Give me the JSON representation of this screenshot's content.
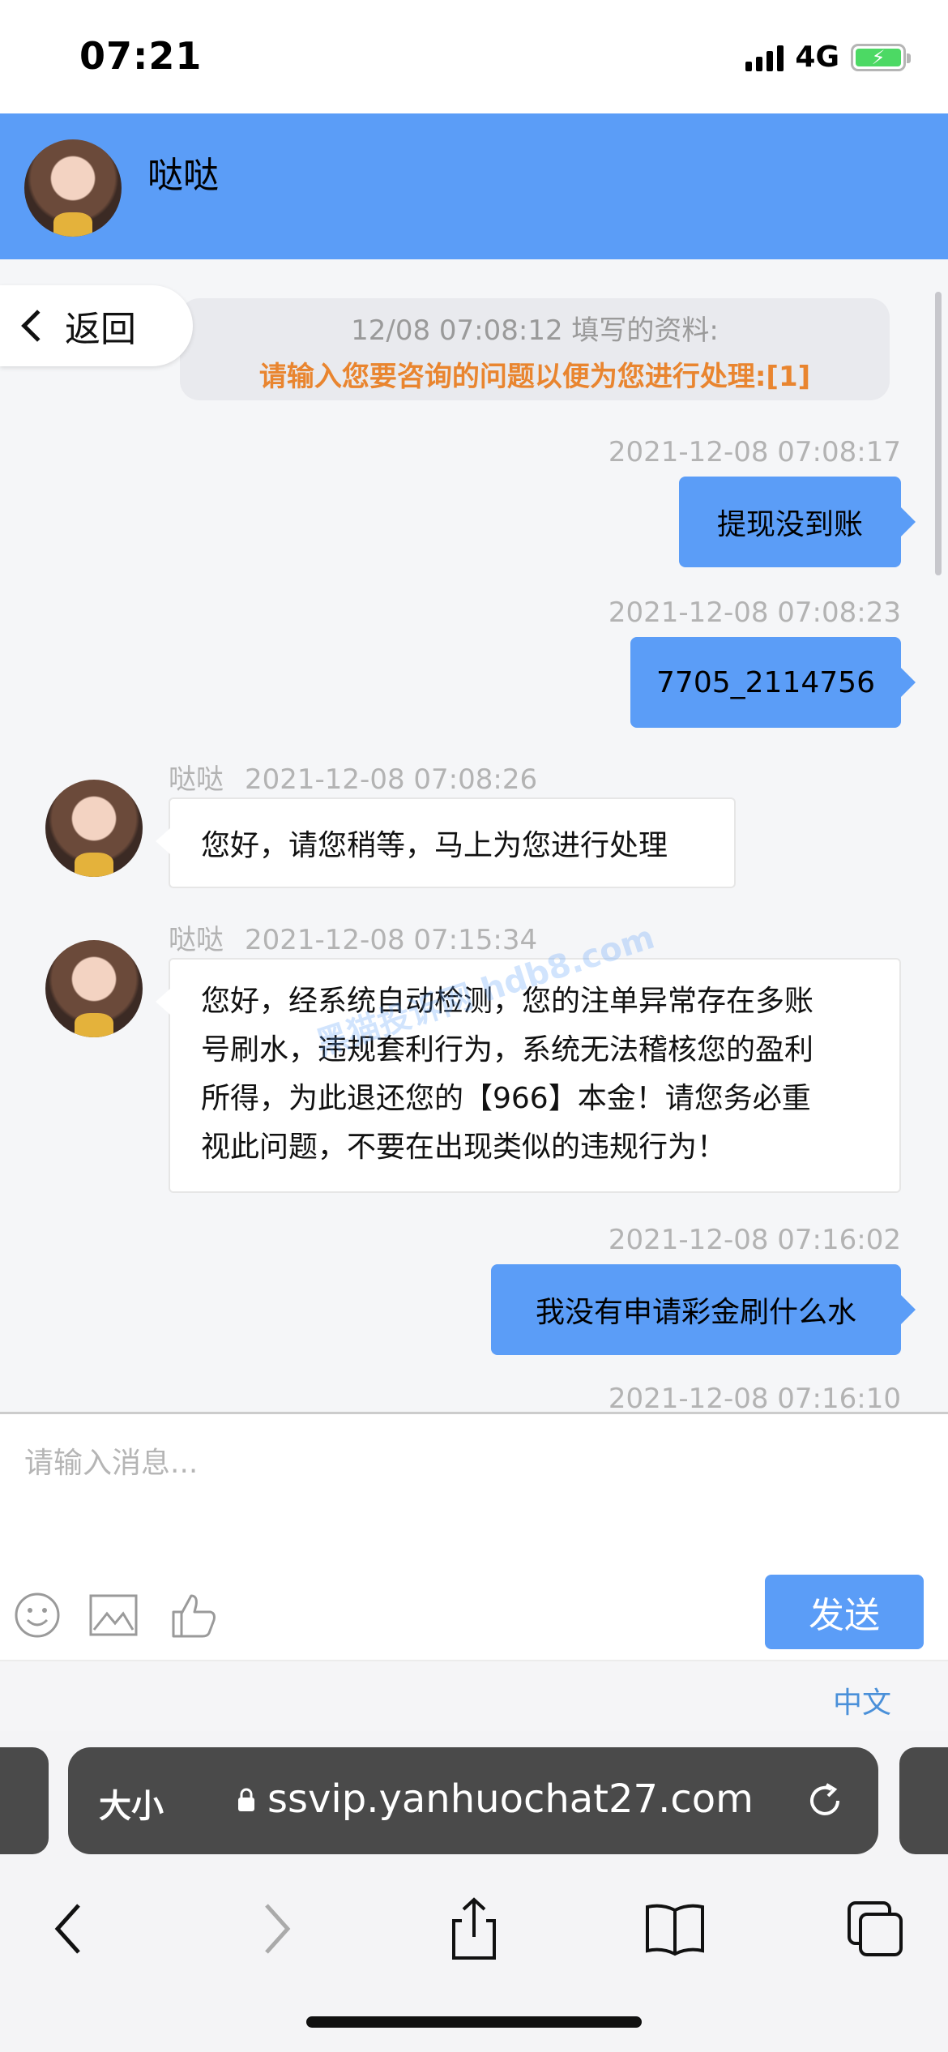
{
  "status_bar": {
    "time": "07:21",
    "network": "4G"
  },
  "header": {
    "agent_name": "哒哒"
  },
  "back_button": {
    "label": "返回"
  },
  "system_notice": {
    "line1": "12/08 07:08:12 填写的资料:",
    "line2": "请输入您要咨询的问题以便为您进行处理:[1]"
  },
  "messages": [
    {
      "direction": "out",
      "timestamp": "2021-12-08 07:08:17",
      "text": "提现没到账"
    },
    {
      "direction": "out",
      "timestamp": "2021-12-08 07:08:23",
      "text": "7705_2114756"
    },
    {
      "direction": "in",
      "sender": "哒哒",
      "timestamp": "2021-12-08 07:08:26",
      "text": "您好，请您稍等，马上为您进行处理"
    },
    {
      "direction": "in",
      "sender": "哒哒",
      "timestamp": "2021-12-08 07:15:34",
      "lines": [
        "您好，经系统自动检测，您的注单异常存在多账",
        "号刷水，违规套利行为，系统无法稽核您的盈利",
        "所得，为此退还您的【966】本金！请您务必重",
        "视此问题，不要在出现类似的违规行为！"
      ]
    },
    {
      "direction": "out",
      "timestamp": "2021-12-08 07:16:02",
      "text": "我没有申请彩金刷什么水"
    },
    {
      "direction": "out",
      "timestamp": "2021-12-08 07:16:10",
      "text": ""
    }
  ],
  "watermark": "黑猫投诉网 hdb8.com",
  "composer": {
    "placeholder": "请输入消息...",
    "send_label": "发送"
  },
  "language": {
    "label": "中文"
  },
  "browser": {
    "text_size_label": "大小",
    "url": "ssvip.yanhuochat27.com"
  },
  "colors": {
    "accent": "#5b9df7",
    "notice_orange": "#e9852f",
    "timestamp_gray": "#b3b3b3"
  }
}
